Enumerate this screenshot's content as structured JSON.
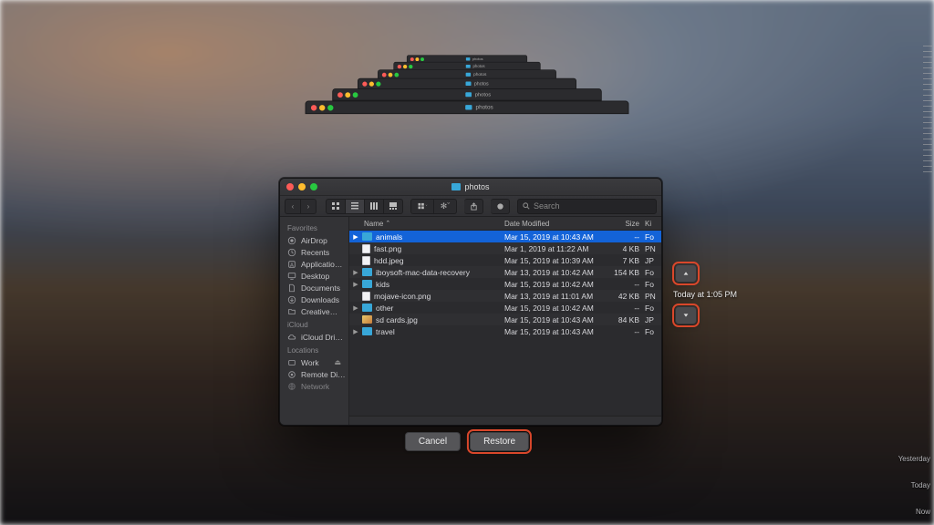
{
  "window": {
    "title": "photos",
    "search_placeholder": "Search"
  },
  "traffic_colors": {
    "close": "#fc5b57",
    "min": "#fdbc2e",
    "max": "#28c840"
  },
  "sidebar": {
    "sections": [
      {
        "title": "Favorites",
        "items": [
          {
            "icon": "airdrop",
            "label": "AirDrop"
          },
          {
            "icon": "recents",
            "label": "Recents"
          },
          {
            "icon": "applications",
            "label": "Applicatio…"
          },
          {
            "icon": "desktop",
            "label": "Desktop"
          },
          {
            "icon": "documents",
            "label": "Documents"
          },
          {
            "icon": "downloads",
            "label": "Downloads"
          },
          {
            "icon": "creative",
            "label": "Creative…"
          }
        ]
      },
      {
        "title": "iCloud",
        "items": [
          {
            "icon": "icloud",
            "label": "iCloud Dri…"
          }
        ]
      },
      {
        "title": "Locations",
        "items": [
          {
            "icon": "work",
            "label": "Work"
          },
          {
            "icon": "remote",
            "label": "Remote Di…"
          },
          {
            "icon": "network",
            "label": "Network"
          }
        ]
      }
    ]
  },
  "columns": {
    "name": "Name",
    "date": "Date Modified",
    "size": "Size",
    "kind": "Ki"
  },
  "files": [
    {
      "name": "animals",
      "type": "folder",
      "date": "Mar 15, 2019 at 10:43 AM",
      "size": "--",
      "kind": "Fo",
      "expand": true,
      "selected": true
    },
    {
      "name": "fast.png",
      "type": "file",
      "date": "Mar 1, 2019 at 11:22 AM",
      "size": "4 KB",
      "kind": "PN"
    },
    {
      "name": "hdd.jpeg",
      "type": "file",
      "date": "Mar 15, 2019 at 10:39 AM",
      "size": "7 KB",
      "kind": "JP"
    },
    {
      "name": "iboysoft-mac-data-recovery",
      "type": "folder",
      "date": "Mar 13, 2019 at 10:42 AM",
      "size": "154 KB",
      "kind": "Fo",
      "expand": true
    },
    {
      "name": "kids",
      "type": "folder",
      "date": "Mar 15, 2019 at 10:42 AM",
      "size": "--",
      "kind": "Fo",
      "expand": true
    },
    {
      "name": "mojave-icon.png",
      "type": "file",
      "date": "Mar 13, 2019 at 11:01 AM",
      "size": "42 KB",
      "kind": "PN"
    },
    {
      "name": "other",
      "type": "folder",
      "date": "Mar 15, 2019 at 10:42 AM",
      "size": "--",
      "kind": "Fo",
      "expand": true
    },
    {
      "name": "sd cards.jpg",
      "type": "image",
      "date": "Mar 15, 2019 at 10:43 AM",
      "size": "84 KB",
      "kind": "JP"
    },
    {
      "name": "travel",
      "type": "folder",
      "date": "Mar 15, 2019 at 10:43 AM",
      "size": "--",
      "kind": "Fo",
      "expand": true
    }
  ],
  "buttons": {
    "cancel": "Cancel",
    "restore": "Restore"
  },
  "time_nav": {
    "label": "Today at 1:05 PM"
  },
  "timeline": {
    "yesterday": "Yesterday",
    "today": "Today",
    "now": "Now"
  }
}
